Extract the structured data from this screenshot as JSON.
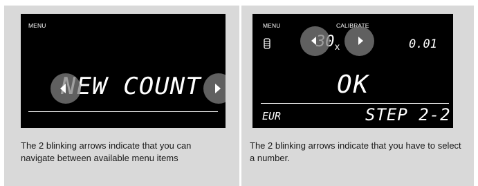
{
  "left_panel": {
    "menu_label": "MENU",
    "display_text": "NEW COUNT",
    "left_arrow_icon": "triangle-left-icon",
    "right_arrow_icon": "triangle-right-icon",
    "caption": "The 2 blinking arrows indicate that you can navigate between available menu items"
  },
  "right_panel": {
    "menu_label": "MENU",
    "mode_label": "CALIBRATE",
    "coin_icon": "coin-stack-icon",
    "count_value": "30",
    "count_suffix": "x",
    "amount_value": "0.01",
    "status_text": "OK",
    "currency": "EUR",
    "step_text": "STEP 2-2",
    "left_arrow_icon": "triangle-left-icon",
    "right_arrow_icon": "triangle-right-icon",
    "caption": "The 2 blinking arrows indicate that you have to select a number."
  },
  "colors": {
    "panel_bg": "#d9d9d9",
    "screen_bg": "#000000",
    "display_fg": "#ffffff",
    "arrow_button": "#808080"
  }
}
